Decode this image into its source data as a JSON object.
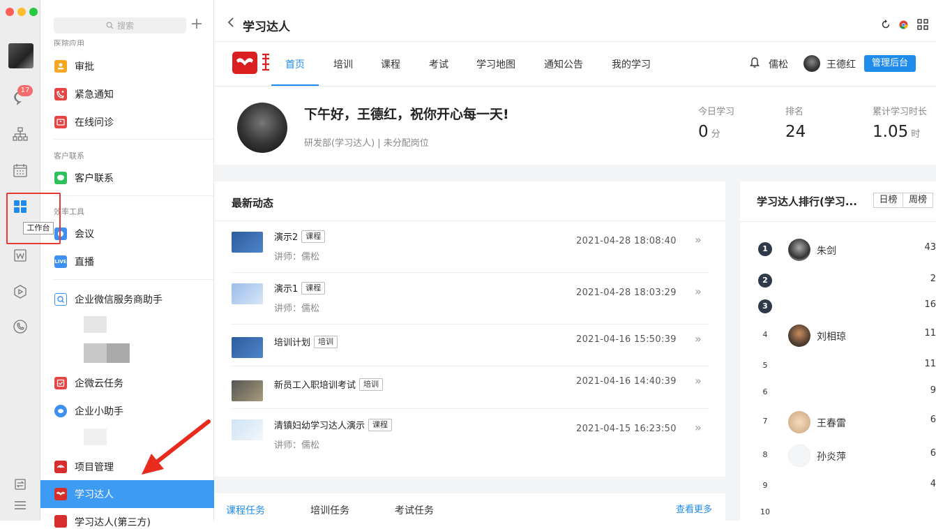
{
  "colors": {
    "accent": "#1f8ceb",
    "sidebar_active": "#3d9bf3",
    "highlight": "#e53935",
    "badge": "#f56c6c"
  },
  "dock": {
    "badge_count": "17",
    "tooltip": "工作台"
  },
  "sidebar": {
    "search_placeholder": "搜索",
    "plus_label": "+",
    "partial_top": "医院应用",
    "items": [
      {
        "label": "审批",
        "icon": "approval-icon"
      },
      {
        "label": "紧急通知",
        "icon": "urgent-notice-icon"
      },
      {
        "label": "在线问诊",
        "icon": "online-consult-icon"
      },
      {
        "label": "客户联系",
        "icon": "customer-contact-icon"
      },
      {
        "label": "会议",
        "icon": "meeting-icon"
      },
      {
        "label": "直播",
        "icon": "live-icon"
      },
      {
        "label": "企业微信服务商助手",
        "icon": "service-helper-icon"
      },
      {
        "label": "企微云任务",
        "icon": "cloud-task-icon"
      },
      {
        "label": "企业小助手",
        "icon": "assistant-icon"
      },
      {
        "label": "项目管理",
        "icon": "project-icon"
      },
      {
        "label": "学习达人",
        "icon": "learning-icon"
      },
      {
        "label": "学习达人(第三方)",
        "icon": "learning-third-icon"
      }
    ],
    "sections": [
      "客户联系",
      "效率工具"
    ],
    "live_text": "LIVE"
  },
  "titlebar": {
    "title": "学习达人"
  },
  "nav": {
    "tabs": [
      "首页",
      "培训",
      "课程",
      "考试",
      "学习地图",
      "通知公告",
      "我的学习"
    ],
    "user_a": "儒松",
    "user_b": "王德红",
    "admin": "管理后台"
  },
  "welcome": {
    "greeting": "下午好，王德红，祝你开心每一天!",
    "dept": "研发部(学习达人) | 未分配岗位",
    "stats": [
      {
        "label": "今日学习",
        "value": "0",
        "unit": "分"
      },
      {
        "label": "排名",
        "value": "24",
        "unit": ""
      },
      {
        "label": "累计学习时长",
        "value": "1.05",
        "unit": "时"
      }
    ]
  },
  "news": {
    "title": "最新动态",
    "items": [
      {
        "title": "演示2",
        "tag": "课程",
        "lecturer": "讲师：儒松",
        "time": "2021-04-28 18:08:40"
      },
      {
        "title": "演示1",
        "tag": "课程",
        "lecturer": "讲师：儒松",
        "time": "2021-04-28 18:03:29"
      },
      {
        "title": "培训计划",
        "tag": "培训",
        "lecturer": "",
        "time": "2021-04-16 15:50:39"
      },
      {
        "title": "新员工入职培训考试",
        "tag": "培训",
        "lecturer": "",
        "time": "2021-04-16 14:40:39"
      },
      {
        "title": "清镇妇幼学习达人演示",
        "tag": "课程",
        "lecturer": "讲师：儒松",
        "time": "2021-04-15 16:23:50"
      }
    ],
    "arrow": "»"
  },
  "bottom_tabs": {
    "tabs": [
      "课程任务",
      "培训任务",
      "考试任务"
    ],
    "more": "查看更多"
  },
  "ranking": {
    "title": "学习达人排行(学习...",
    "tabs": [
      "日榜",
      "周榜"
    ],
    "rows": [
      {
        "rank": "1",
        "name": "朱剑",
        "score": "43"
      },
      {
        "rank": "2",
        "name": "",
        "score": "2"
      },
      {
        "rank": "3",
        "name": "",
        "score": "16"
      },
      {
        "rank": "4",
        "name": "刘相琼",
        "score": "11"
      },
      {
        "rank": "5",
        "name": "",
        "score": "11"
      },
      {
        "rank": "6",
        "name": "",
        "score": "9"
      },
      {
        "rank": "7",
        "name": "王春雷",
        "score": "6"
      },
      {
        "rank": "8",
        "name": "孙炎萍",
        "score": "6"
      },
      {
        "rank": "9",
        "name": "",
        "score": "4"
      },
      {
        "rank": "10",
        "name": "",
        "score": ""
      }
    ]
  }
}
